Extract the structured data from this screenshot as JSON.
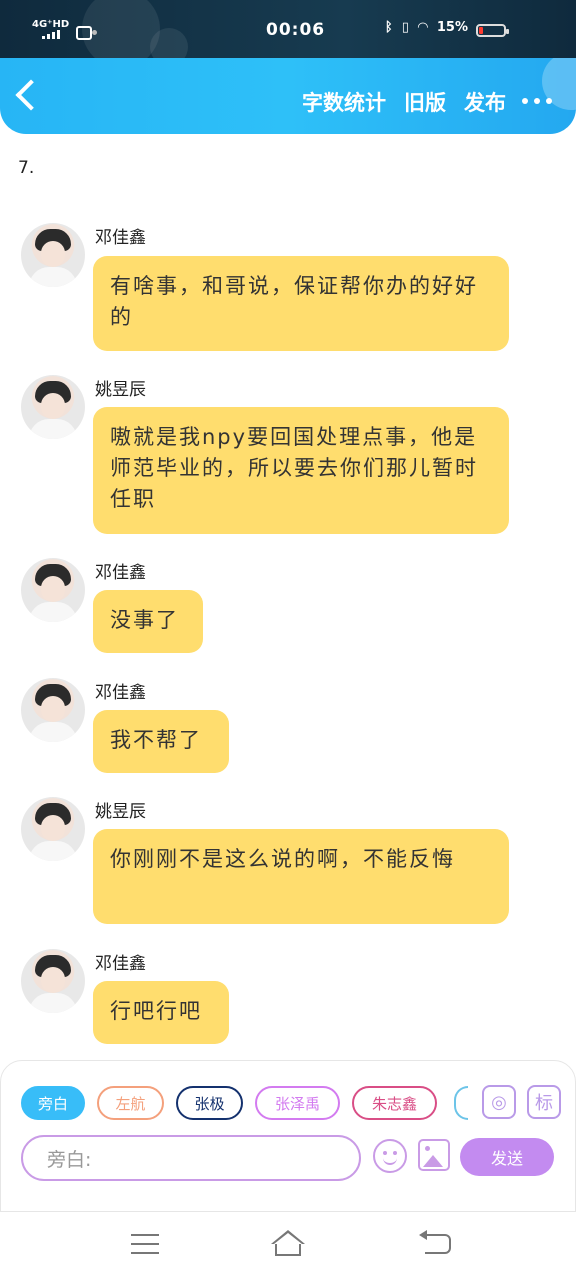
{
  "status_bar": {
    "network": "4G⁺HD",
    "time": "00:06",
    "battery_text": "15%",
    "battery_level_percent": 15,
    "icons": [
      "signal-icon",
      "vpn-icon",
      "bluetooth-icon",
      "vibrate-icon",
      "wifi-icon",
      "battery-icon"
    ]
  },
  "nav": {
    "back_icon": "back-chevron-icon",
    "actions": [
      "字数统计",
      "旧版",
      "发布"
    ],
    "more_icon": "more-dots-icon"
  },
  "chapter_label": "7.",
  "messages": [
    {
      "sender": "邓佳鑫",
      "text": "有啥事，和哥说，保证帮你办的好好的"
    },
    {
      "sender": "姚昱辰",
      "text": "嗷就是我npy要回国处理点事，他是师范毕业的，所以要去你们那儿暂时任职"
    },
    {
      "sender": "邓佳鑫",
      "text": "没事了"
    },
    {
      "sender": "邓佳鑫",
      "text": "我不帮了"
    },
    {
      "sender": "姚昱辰",
      "text": "你刚刚不是这么说的啊，不能反悔"
    },
    {
      "sender": "邓佳鑫",
      "text": "行吧行吧"
    }
  ],
  "composer": {
    "chips": [
      "旁白",
      "左航",
      "张极",
      "张泽禹",
      "朱志鑫"
    ],
    "active_chip": "旁白",
    "icon_buttons": [
      "role-icon",
      "tag-icon"
    ],
    "tag_button_label": "标",
    "input_placeholder": "旁白:",
    "send_label": "发送",
    "colors": {
      "active": "#38bdf8",
      "accent": "#c38bf0"
    }
  },
  "system_nav": [
    "menu-icon",
    "home-icon",
    "back-icon"
  ],
  "colors": {
    "bubble": "#ffdd6e",
    "nav_blue": "#27b5f5"
  }
}
